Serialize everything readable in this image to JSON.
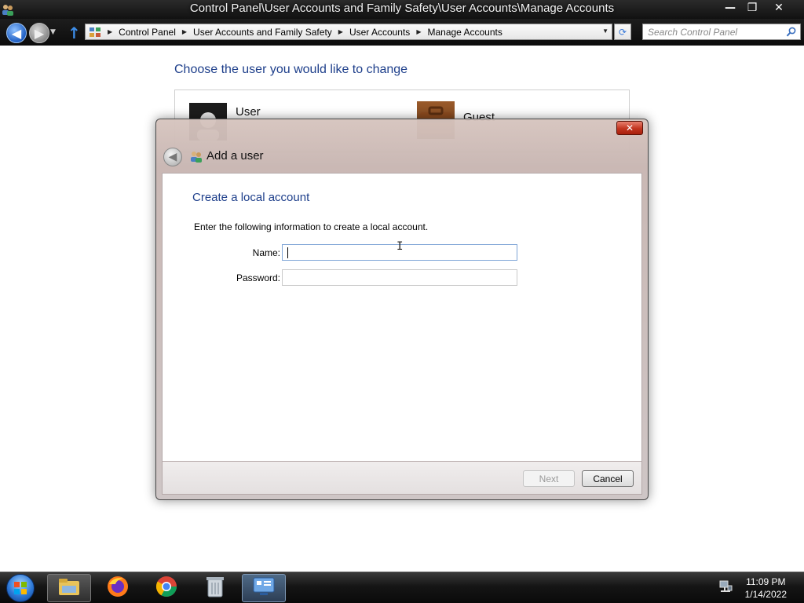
{
  "window": {
    "title": "Control Panel\\User Accounts and Family Safety\\User Accounts\\Manage Accounts",
    "minimize_label": "—",
    "restore_label": "❐",
    "close_label": "✕"
  },
  "nav": {
    "back_label": "◀",
    "forward_label": "▶",
    "dropdown_label": "▼",
    "up_label": "↑",
    "breadcrumbs": [
      "Control Panel",
      "User Accounts and Family Safety",
      "User Accounts",
      "Manage Accounts"
    ],
    "crumb_separator": "▶",
    "address_dropdown": "▼",
    "refresh_label": "⟳",
    "search_placeholder": "Search Control Panel"
  },
  "main": {
    "heading": "Choose the user you would like to change",
    "accounts": [
      {
        "name": "User"
      },
      {
        "name": "Guest"
      }
    ]
  },
  "dialog": {
    "title": "Add a user",
    "close_label": "✕",
    "back_label": "◀",
    "heading": "Create a local account",
    "instruction": "Enter the following information to create a local account.",
    "fields": {
      "name_label": "Name:",
      "name_value": "",
      "password_label": "Password:",
      "password_value": ""
    },
    "buttons": {
      "next": "Next",
      "cancel": "Cancel"
    }
  },
  "taskbar": {
    "pinned": [
      "file-explorer",
      "firefox",
      "chrome",
      "recycle-bin",
      "control-panel"
    ],
    "time": "11:09 PM",
    "date": "1/14/2022"
  },
  "colors": {
    "heading_blue": "#1e3f8b",
    "close_red": "#c2351f",
    "taskbar_dark": "#151515"
  }
}
